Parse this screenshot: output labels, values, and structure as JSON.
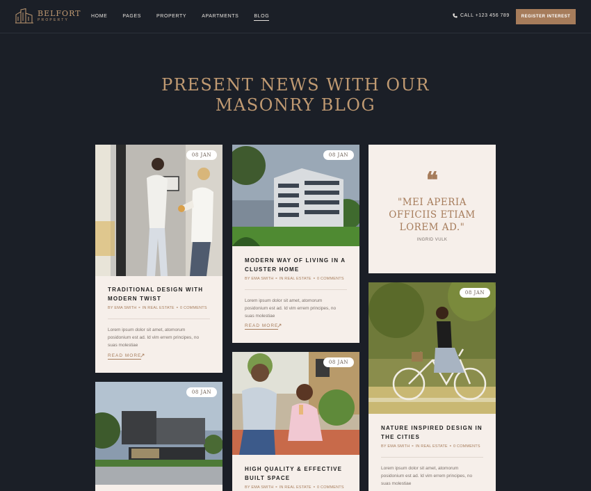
{
  "header": {
    "logo_name": "BELFORT",
    "logo_sub": "PROPERTY",
    "nav": [
      "HOME",
      "PAGES",
      "PROPERTY",
      "APARTMENTS",
      "BLOG"
    ],
    "phone": "CALL +123 456 789",
    "cta": "REGISTER INTEREST"
  },
  "headline": {
    "line1": "PRESENT NEWS WITH OUR",
    "line2": "MASONRY BLOG"
  },
  "posts": [
    {
      "date": "08 JAN",
      "title_l1": "TRADITIONAL DESIGN WITH",
      "title_l2": "MODERN TWIST",
      "meta": "BY EMA SMITH ⚬ IN REAL ESTATE ⚬ 0 COMMENTS",
      "excerpt_l1": "Lorem ipsum dolor sit amet, atomorum",
      "excerpt_l2": "posidonium est ad. Id vim errem principes, no",
      "excerpt_l3": "suas molestiae",
      "read_more": "READ MORE"
    },
    {
      "date": "08 JAN",
      "title_l1": "MODERN WAY OF LIVING IN A",
      "title_l2": "CLUSTER HOME",
      "meta": "BY EMA SMITH ⚬ IN REAL ESTATE ⚬ 0 COMMENTS",
      "excerpt_l1": "Lorem ipsum dolor sit amet, atomorum",
      "excerpt_l2": "posidonium est ad. Id vim errem principes, no",
      "excerpt_l3": "suas molestiae",
      "read_more": "READ MORE"
    },
    {
      "date": "08 JAN",
      "title_l1": "NATURE INSPIRED DESIGN IN",
      "title_l2": "THE CITIES",
      "meta": "BY EMA SMITH ⚬ IN REAL ESTATE ⚬ 0 COMMENTS",
      "excerpt_l1": "Lorem ipsum dolor sit amet, atomorum",
      "excerpt_l2": "posidonium est ad. Id vim errem principes, no",
      "excerpt_l3": "suas molestiae"
    },
    {
      "date": "08 JAN"
    },
    {
      "date": "08 JAN",
      "title_l1": "HIGH QUALITY & EFFECTIVE",
      "title_l2": "BUILT SPACE",
      "meta": "BY EMA SMITH ⚬ IN REAL ESTATE ⚬ 0 COMMENTS"
    }
  ],
  "quote": {
    "mark": "❝",
    "l1": "\"MEI APERIA",
    "l2": "OFFICIIS ETIAM",
    "l3": "LOREM AD.\"",
    "author": "INGRID VULK"
  },
  "colors": {
    "bg": "#1b1f27",
    "accent": "#a67c5b",
    "card": "#f6efea"
  },
  "icons": [
    "building-logo-icon",
    "phone-icon",
    "arrow-up-right-icon",
    "quote-icon"
  ]
}
